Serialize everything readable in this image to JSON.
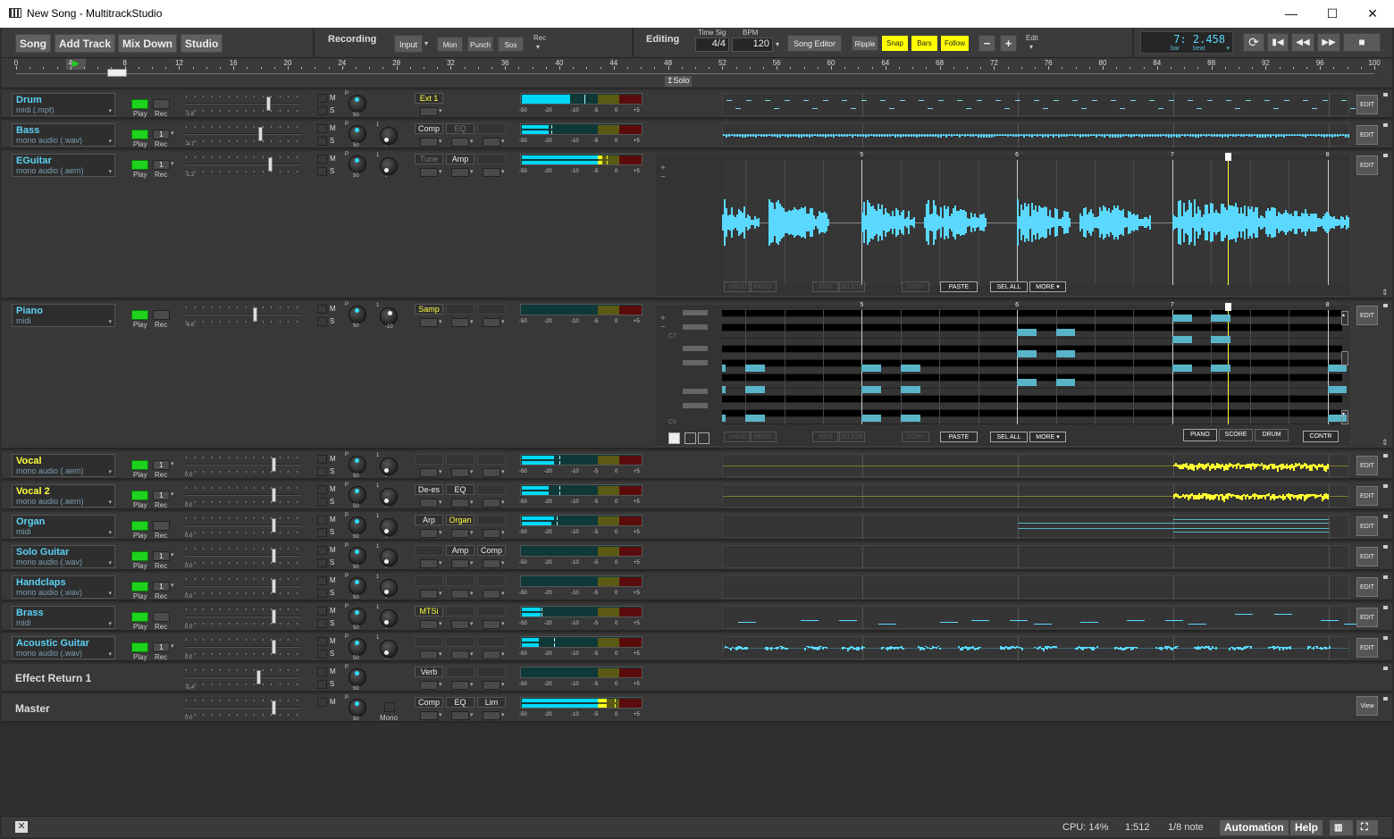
{
  "window": {
    "title": "New Song - MultitrackStudio",
    "minimize": "—",
    "maximize": "☐",
    "close": "✕"
  },
  "toolbar": {
    "main_buttons": [
      "Song",
      "Add Track",
      "Mix Down",
      "Studio"
    ],
    "recording_label": "Recording",
    "input_label": "Input",
    "mon_label": "Mon",
    "punch_label": "Punch",
    "sos_label": "Sos",
    "rec_label": "Rec",
    "editing_label": "Editing",
    "time_sig_label": "Time Sig",
    "time_sig_value": "4/4",
    "bpm_label": "BPM",
    "bpm_value": "120",
    "song_editor_label": "Song Editor",
    "ripple_label": "Ripple",
    "snap_label": "Snap",
    "bars_label": "Bars",
    "follow_label": "Follow",
    "zoom_out": "−",
    "zoom_in": "+",
    "edit_label": "Edit",
    "position_display": "7: 2.458",
    "position_bar_label": "bar",
    "position_beat_label": "beat",
    "transport": [
      "loop-icon",
      "go-to-start-icon",
      "rewind-icon",
      "fast-forward-icon",
      "stop-icon"
    ],
    "highlight_color": "#ffff00"
  },
  "ruler": {
    "ticks": [
      0,
      4,
      8,
      12,
      16,
      20,
      24,
      28,
      32,
      36,
      40,
      44,
      48,
      52,
      56,
      60,
      64,
      68,
      72,
      76,
      80,
      84,
      88,
      92,
      96,
      100
    ],
    "solo_label": "Solo"
  },
  "meter_scale": [
    "-50",
    "-20",
    "-10",
    "-5",
    "0",
    "+5"
  ],
  "tracks": [
    {
      "name": "Drum",
      "type": "midi (.mpt)",
      "color": "#5bd2f5",
      "play": "Play",
      "rec": "Rec",
      "rec_channel": "",
      "fader": -1.8,
      "pan": "50",
      "vol": null,
      "fx": [
        {
          "label": "Ext 1",
          "style": "inst"
        }
      ],
      "meter": [
        -12
      ],
      "peak": -8,
      "lane": "drum",
      "edit": "EDIT"
    },
    {
      "name": "Bass",
      "type": "mono audio (.wav)",
      "color": "#5bd2f5",
      "play": "Play",
      "rec": "Rec",
      "rec_channel": "1",
      "fader": -4.7,
      "pan": "50",
      "vol": "-",
      "fx": [
        {
          "label": "Comp",
          "style": "on"
        },
        {
          "label": "EQ",
          "style": "off"
        },
        {
          "label": "",
          "style": "empty"
        }
      ],
      "meter": [
        -20,
        -20
      ],
      "peak": -19,
      "lane": "bass",
      "edit": "EDIT"
    },
    {
      "name": "EGuitar",
      "type": "mono audio (.aem)",
      "color": "#5bd2f5",
      "play": "Play",
      "rec": "Rec",
      "rec_channel": "1",
      "fader": -1.2,
      "pan": "50",
      "vol": "-",
      "fx": [
        {
          "label": "Tune",
          "style": "off"
        },
        {
          "label": "Amp",
          "style": "on"
        },
        {
          "label": "",
          "style": "empty"
        }
      ],
      "meter": [
        -4,
        -4
      ],
      "peak": -3,
      "lane": "audio-editor",
      "edit": "EDIT"
    },
    {
      "name": "Piano",
      "type": "midi",
      "color": "#5bd2f5",
      "play": "Play",
      "rec": "Rec",
      "rec_channel": "",
      "fader": -6.8,
      "pan": "50",
      "vol": "-10",
      "fx": [
        {
          "label": "Samp",
          "style": "inst"
        },
        {
          "label": "",
          "style": "empty"
        },
        {
          "label": "",
          "style": "empty"
        }
      ],
      "meter": [
        null,
        null
      ],
      "peak": null,
      "lane": "piano-editor",
      "edit": "EDIT"
    },
    {
      "name": "Vocal",
      "type": "mono audio (.aem)",
      "color": "#ffff40",
      "play": "Play",
      "rec": "Rec",
      "rec_channel": "1",
      "fader": 0.0,
      "pan": "50",
      "vol": "-",
      "fx": [
        {
          "label": "",
          "style": "empty"
        },
        {
          "label": "",
          "style": "empty"
        },
        {
          "label": "",
          "style": "empty"
        }
      ],
      "meter": [
        -18,
        -18
      ],
      "peak": -16,
      "lane": "vocal",
      "edit": "EDIT"
    },
    {
      "name": "Vocal 2",
      "type": "mono audio (.aem)",
      "color": "#ffff40",
      "play": "Play",
      "rec": "Rec",
      "rec_channel": "1",
      "fader": 0.0,
      "pan": "50",
      "vol": "-",
      "fx": [
        {
          "label": "De-es",
          "style": "on"
        },
        {
          "label": "EQ",
          "style": "on"
        },
        {
          "label": "",
          "style": "empty"
        }
      ],
      "meter": [
        -20,
        -20
      ],
      "peak": -16,
      "lane": "vocal",
      "edit": "EDIT"
    },
    {
      "name": "Organ",
      "type": "midi",
      "color": "#5bd2f5",
      "play": "Play",
      "rec": "Rec",
      "rec_channel": "",
      "fader": 0.0,
      "pan": "50",
      "vol": "-",
      "fx": [
        {
          "label": "Arp",
          "style": "on"
        },
        {
          "label": "Organ",
          "style": "inst"
        },
        {
          "label": "",
          "style": "empty"
        }
      ],
      "meter": [
        -18,
        -19
      ],
      "peak": -17,
      "lane": "organ",
      "edit": "EDIT"
    },
    {
      "name": "Solo Guitar",
      "type": "mono audio (.wav)",
      "color": "#5bd2f5",
      "play": "Play",
      "rec": "Rec",
      "rec_channel": "1",
      "fader": 0.0,
      "pan": "50",
      "vol": "-",
      "fx": [
        {
          "label": "",
          "style": "empty"
        },
        {
          "label": "Amp",
          "style": "on"
        },
        {
          "label": "Comp",
          "style": "on"
        }
      ],
      "meter": [
        null,
        null
      ],
      "peak": null,
      "lane": "empty",
      "edit": "EDIT"
    },
    {
      "name": "Handclaps",
      "type": "mono audio (.wav)",
      "color": "#5bd2f5",
      "play": "Play",
      "rec": "Rec",
      "rec_channel": "1",
      "fader": 0.0,
      "pan": "50",
      "vol": "-",
      "fx": [
        {
          "label": "",
          "style": "empty"
        },
        {
          "label": "",
          "style": "empty"
        },
        {
          "label": "",
          "style": "empty"
        }
      ],
      "meter": [
        null,
        null
      ],
      "peak": null,
      "lane": "empty",
      "edit": "EDIT"
    },
    {
      "name": "Brass",
      "type": "midi",
      "color": "#5bd2f5",
      "play": "Play",
      "rec": "Rec",
      "rec_channel": "",
      "fader": 0.0,
      "pan": "50",
      "vol": "-",
      "fx": [
        {
          "label": "MTSi",
          "style": "inst"
        },
        {
          "label": "",
          "style": "empty"
        },
        {
          "label": "",
          "style": "empty"
        }
      ],
      "meter": [
        -30,
        -30
      ],
      "peak": -29,
      "lane": "brass",
      "edit": "EDIT"
    },
    {
      "name": "Acoustic Guitar",
      "type": "mono audio (.wav)",
      "color": "#5bd2f5",
      "play": "Play",
      "rec": "Rec",
      "rec_channel": "1",
      "fader": 0.0,
      "pan": "50",
      "vol": "-",
      "fx": [
        {
          "label": "",
          "style": "empty"
        },
        {
          "label": "",
          "style": "empty"
        },
        {
          "label": "",
          "style": "empty"
        }
      ],
      "meter": [
        -32,
        -32
      ],
      "peak": -18,
      "lane": "acoustic",
      "edit": "EDIT"
    },
    {
      "name": "Effect Return 1",
      "type": "",
      "color": "#dddddd",
      "fader": -5.4,
      "pan": "50",
      "vol": null,
      "fx": [
        {
          "label": "Verb",
          "style": "on"
        },
        {
          "label": "",
          "style": "empty"
        },
        {
          "label": "",
          "style": "empty"
        }
      ],
      "meter": [
        null,
        null
      ],
      "peak": null,
      "lane": "none",
      "edit": null,
      "bus": true
    },
    {
      "name": "Master",
      "type": "",
      "color": "#dddddd",
      "fader": 0.0,
      "pan": "50",
      "vol": null,
      "mono": "Mono",
      "fx": [
        {
          "label": "Comp",
          "style": "on"
        },
        {
          "label": "EQ",
          "style": "on"
        },
        {
          "label": "Lim",
          "style": "on"
        }
      ],
      "meter": [
        -3,
        -3
      ],
      "peak": -1,
      "lane": "none",
      "edit": "View",
      "bus": true,
      "master": true
    }
  ],
  "editor": {
    "bar_labels": [
      "5",
      "6",
      "7",
      "8"
    ],
    "visible_bars": [
      4.1,
      8.12
    ],
    "playhead_bar": 7.36,
    "buttons": [
      {
        "label": "UNDO",
        "enabled": false
      },
      {
        "label": "REDO",
        "enabled": false
      },
      {
        "label": "EDIT",
        "enabled": false
      },
      {
        "label": "DELETE",
        "enabled": false
      },
      {
        "label": "COPY",
        "enabled": false
      },
      {
        "label": "PASTE",
        "enabled": true
      },
      {
        "label": "SEL ALL",
        "enabled": true
      },
      {
        "label": "MORE ▾",
        "enabled": true
      }
    ],
    "piano_tabs": [
      "PIANO",
      "SCORE",
      "DRUM"
    ],
    "contr_label": "CONTR",
    "key_labels": [
      "C7",
      "C6"
    ],
    "zoom_plus": "+",
    "zoom_minus": "−",
    "note_color": "#5ab4c8",
    "wave_color": "#5ad8ff",
    "notes": [
      {
        "bar": 4.0,
        "pitch": "G6",
        "len": 0.125
      },
      {
        "bar": 4.0,
        "pitch": "E6",
        "len": 0.125
      },
      {
        "bar": 4.0,
        "pitch": "C6",
        "len": 0.125
      },
      {
        "bar": 4.25,
        "pitch": "G6",
        "len": 0.125
      },
      {
        "bar": 4.25,
        "pitch": "E6",
        "len": 0.125
      },
      {
        "bar": 4.25,
        "pitch": "C6",
        "len": 0.125
      },
      {
        "bar": 5.0,
        "pitch": "G6",
        "len": 0.125
      },
      {
        "bar": 5.0,
        "pitch": "E6",
        "len": 0.125
      },
      {
        "bar": 5.0,
        "pitch": "C6",
        "len": 0.125
      },
      {
        "bar": 5.25,
        "pitch": "G6",
        "len": 0.125
      },
      {
        "bar": 5.25,
        "pitch": "E6",
        "len": 0.125
      },
      {
        "bar": 5.25,
        "pitch": "C6",
        "len": 0.125
      },
      {
        "bar": 6.0,
        "pitch": "C7",
        "len": 0.125
      },
      {
        "bar": 6.0,
        "pitch": "A6",
        "len": 0.125
      },
      {
        "bar": 6.0,
        "pitch": "F6",
        "len": 0.125
      },
      {
        "bar": 6.25,
        "pitch": "C7",
        "len": 0.125
      },
      {
        "bar": 6.25,
        "pitch": "A6",
        "len": 0.125
      },
      {
        "bar": 6.25,
        "pitch": "F6",
        "len": 0.125
      },
      {
        "bar": 7.0,
        "pitch": "D7",
        "len": 0.125
      },
      {
        "bar": 7.0,
        "pitch": "B6",
        "len": 0.125
      },
      {
        "bar": 7.0,
        "pitch": "G6",
        "len": 0.125
      },
      {
        "bar": 7.25,
        "pitch": "D7",
        "len": 0.125
      },
      {
        "bar": 7.25,
        "pitch": "B6",
        "len": 0.125
      },
      {
        "bar": 7.25,
        "pitch": "G6",
        "len": 0.125
      },
      {
        "bar": 8.0,
        "pitch": "G6",
        "len": 0.125
      },
      {
        "bar": 8.0,
        "pitch": "E6",
        "len": 0.125
      },
      {
        "bar": 8.0,
        "pitch": "C6",
        "len": 0.125
      }
    ],
    "audio_clips": [
      [
        4.1,
        4.34
      ],
      [
        4.4,
        4.79
      ],
      [
        5.0,
        5.34
      ],
      [
        5.4,
        5.8
      ],
      [
        6.0,
        6.34
      ],
      [
        6.4,
        6.85
      ],
      [
        7.0,
        8.14
      ]
    ]
  },
  "status": {
    "cpu": "CPU: 14%",
    "ratio": "1:512",
    "snap": "1/8 note",
    "automation": "Automation",
    "help": "Help"
  }
}
